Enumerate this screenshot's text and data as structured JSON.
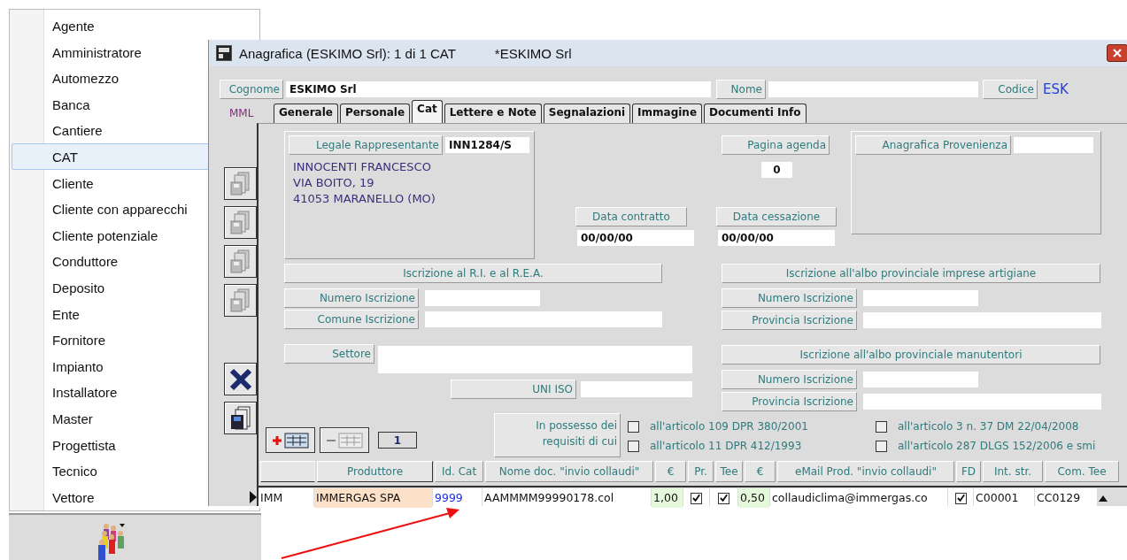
{
  "menu": {
    "items": [
      {
        "label": "Agente",
        "selected": false
      },
      {
        "label": "Amministratore",
        "selected": false
      },
      {
        "label": "Automezzo",
        "selected": false
      },
      {
        "label": "Banca",
        "selected": false
      },
      {
        "label": "Cantiere",
        "selected": false
      },
      {
        "label": "CAT",
        "selected": true
      },
      {
        "label": "Cliente",
        "selected": false
      },
      {
        "label": "Cliente con apparecchi",
        "selected": false
      },
      {
        "label": "Cliente potenziale",
        "selected": false
      },
      {
        "label": "Conduttore",
        "selected": false
      },
      {
        "label": "Deposito",
        "selected": false
      },
      {
        "label": "Ente",
        "selected": false
      },
      {
        "label": "Fornitore",
        "selected": false
      },
      {
        "label": "Impianto",
        "selected": false
      },
      {
        "label": "Installatore",
        "selected": false
      },
      {
        "label": "Master",
        "selected": false
      },
      {
        "label": "Progettista",
        "selected": false
      },
      {
        "label": "Tecnico",
        "selected": false
      },
      {
        "label": "Vettore",
        "selected": false
      }
    ]
  },
  "window": {
    "title": "Anagrafica (ESKIMO Srl): 1 di 1  CAT",
    "subtitle": "*ESKIMO Srl"
  },
  "header": {
    "cognome_label": "Cognome",
    "cognome": "ESKIMO Srl",
    "nome_label": "Nome",
    "codice_label": "Codice",
    "codice": "ESK"
  },
  "mml": "MML",
  "tabs": [
    {
      "label": "Generale",
      "selected": false
    },
    {
      "label": "Personale",
      "selected": false
    },
    {
      "label": "Cat",
      "selected": true
    },
    {
      "label": "Lettere e Note",
      "selected": false
    },
    {
      "label": "Segnalazioni",
      "selected": false
    },
    {
      "label": "Immagine",
      "selected": false
    },
    {
      "label": "Documenti Info",
      "selected": false
    }
  ],
  "legal": {
    "label": "Legale Rappresentante",
    "code": "INN1284/S",
    "address": [
      "INNOCENTI FRANCESCO",
      "VIA BOITO, 19",
      "41053 MARANELLO (MO)"
    ]
  },
  "agenda": {
    "label": "Pagina agenda",
    "value": "0"
  },
  "dates": [
    {
      "label": "Data contratto",
      "value": "00/00/00"
    },
    {
      "label": "Data cessazione",
      "value": "00/00/00"
    }
  ],
  "provenienza": {
    "label": "Anagrafica Provenienza"
  },
  "rea": {
    "title": "Iscrizione al R.I. e al R.E.A.",
    "fields": [
      {
        "label": "Numero Iscrizione"
      },
      {
        "label": "Comune Iscrizione"
      }
    ]
  },
  "settore": {
    "label": "Settore"
  },
  "uni_iso": {
    "label": "UNI ISO"
  },
  "artigiani": {
    "title": "Iscrizione all'albo provinciale imprese artigiane",
    "fields": [
      {
        "label": "Numero Iscrizione"
      },
      {
        "label": "Provincia Iscrizione"
      }
    ]
  },
  "manutentori": {
    "title": "Iscrizione all'albo provinciale manutentori",
    "fields": [
      {
        "label": "Numero Iscrizione"
      },
      {
        "label": "Provincia Iscrizione"
      }
    ]
  },
  "requisiti": {
    "label": "In possesso dei requisiti di cui",
    "options": [
      {
        "label": "all'articolo 109 DPR 380/2001",
        "checked": false
      },
      {
        "label": "all'articolo 11 DPR 412/1993",
        "checked": false
      },
      {
        "label": "all'articolo 3 n. 37 DM 22/04/2008",
        "checked": false
      },
      {
        "label": "all'articolo 287 DLGS 152/2006 e smi",
        "checked": false
      }
    ]
  },
  "record_counter": "1",
  "table": {
    "columns": [
      "",
      "Produttore",
      "Id. Cat",
      "Nome doc. \"invio collaudi\"",
      "€",
      "Pr.",
      "Tee",
      "€",
      "eMail Prod. \"invio collaudi\"",
      "FD",
      "Int. str.",
      "Com. Tee"
    ],
    "rows": [
      {
        "cells": [
          {
            "kind": "text",
            "value": "IMM"
          },
          {
            "kind": "name",
            "value": "IMMERGAS SPA"
          },
          {
            "kind": "id",
            "value": "9999"
          },
          {
            "kind": "text",
            "value": "AAMMMM99990178.col"
          },
          {
            "kind": "money",
            "value": "1,00"
          },
          {
            "kind": "check",
            "checked": true
          },
          {
            "kind": "check",
            "checked": true
          },
          {
            "kind": "money",
            "value": "0,50"
          },
          {
            "kind": "text",
            "value": "collaudiclima@immergas.co"
          },
          {
            "kind": "check",
            "checked": true
          },
          {
            "kind": "text",
            "value": "C00001"
          },
          {
            "kind": "text",
            "value": "CC0129"
          }
        ]
      }
    ]
  }
}
